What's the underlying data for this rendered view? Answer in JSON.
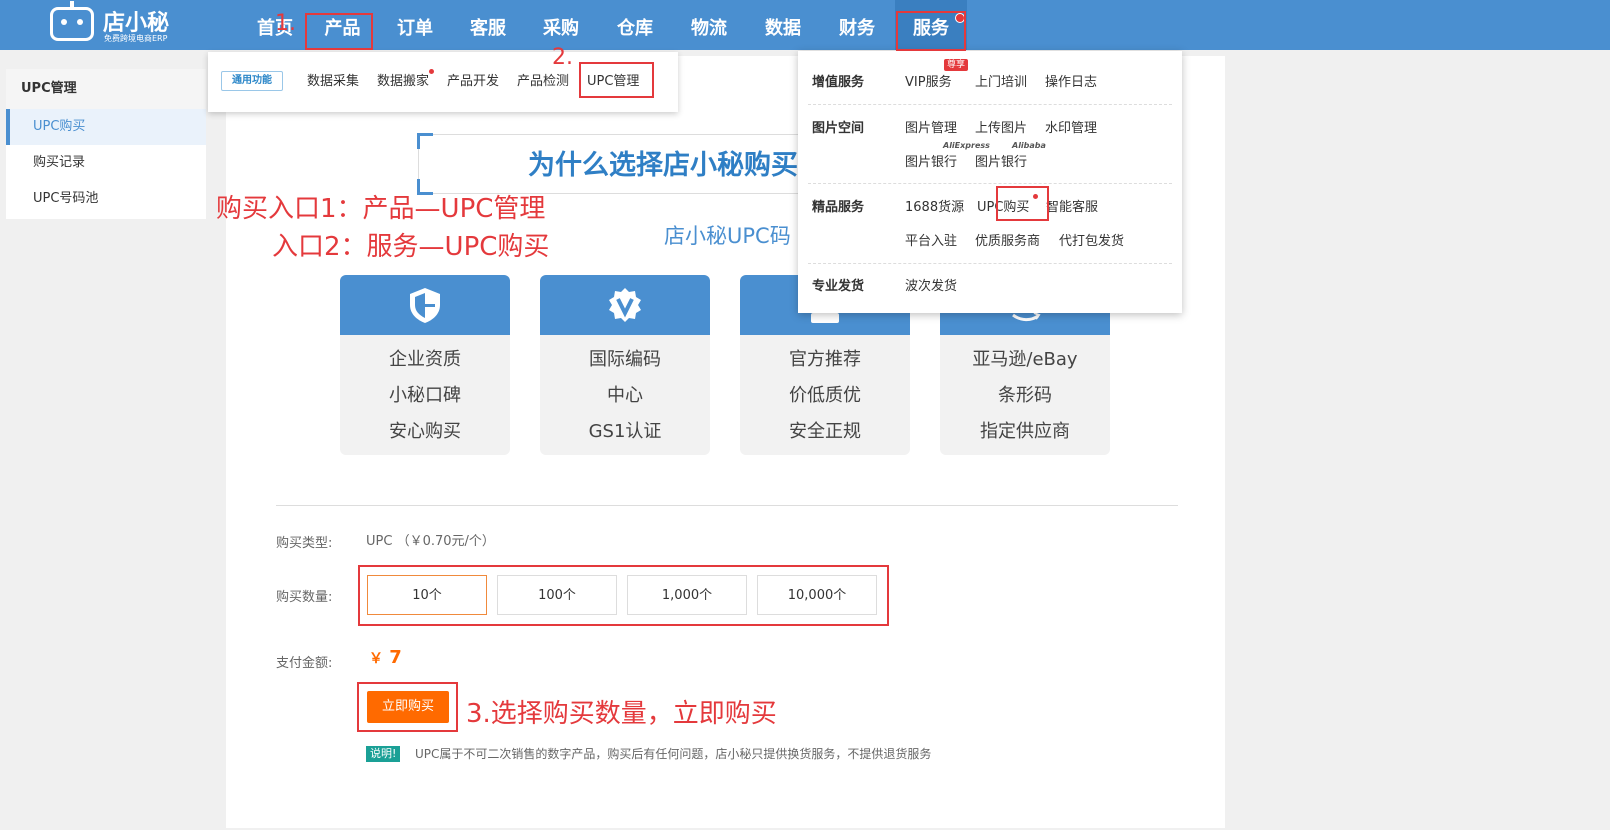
{
  "logo": {
    "name": "店小秘",
    "tagline": "免费跨境电商ERP"
  },
  "nav": [
    "首页",
    "产品",
    "订单",
    "客服",
    "采购",
    "仓库",
    "物流",
    "数据",
    "财务",
    "服务"
  ],
  "sidebar": {
    "title": "UPC管理",
    "items": [
      "UPC购买",
      "购买记录",
      "UPC号码池"
    ]
  },
  "product_menu": {
    "badge": "通用功能",
    "items": [
      "数据采集",
      "数据搬家",
      "产品开发",
      "产品检测",
      "UPC管理"
    ]
  },
  "service_menu": {
    "sections": [
      {
        "title": "增值服务",
        "items": [
          "VIP服务",
          "上门培训",
          "操作日志"
        ]
      },
      {
        "title": "图片空间",
        "items": [
          "图片管理",
          "上传图片",
          "水印管理",
          "图片银行",
          "图片银行"
        ]
      },
      {
        "title": "精品服务",
        "items": [
          "1688货源",
          "UPC购买",
          "智能客服",
          "平台入驻",
          "优质服务商",
          "代打包发货"
        ]
      },
      {
        "title": "专业发货",
        "items": [
          "波次发货"
        ]
      }
    ],
    "vip_tag": "尊享",
    "aliexpress_tag": "AliExpress",
    "alibaba_tag": "Alibaba"
  },
  "annotations": {
    "step1": "1.",
    "step2": "2.",
    "entry1": "购买入口1：产品—UPC管理",
    "entry2": "入口2：服务—UPC购买",
    "step3": "3.选择购买数量，立即购买"
  },
  "main": {
    "headline": "为什么选择店小秘购买",
    "subhead": "店小秘UPC码",
    "cards": [
      {
        "icon": "shield-icon",
        "lines": [
          "企业资质",
          "小秘口碑",
          "安心购买"
        ]
      },
      {
        "icon": "verified-badge-icon",
        "lines": [
          "国际编码",
          "中心",
          "GS1认证"
        ]
      },
      {
        "icon": "thumbs-up-icon",
        "lines": [
          "官方推荐",
          "价低质优",
          "安全正规"
        ]
      },
      {
        "icon": "amazon-icon",
        "lines": [
          "亚马逊/eBay",
          "条形码",
          "指定供应商"
        ]
      }
    ],
    "purchase_type_label": "购买类型:",
    "purchase_type_value": "UPC （￥0.70元/个）",
    "quantity_label": "购买数量:",
    "quantities": [
      "10个",
      "100个",
      "1,000个",
      "10,000个"
    ],
    "selected_quantity": "10个",
    "amount_label": "支付金额:",
    "currency": "￥",
    "amount": "7",
    "buy_button": "立即购买",
    "note_tag": "说明!",
    "note": "UPC属于不可二次销售的数字产品，购买后有任何问题，店小秘只提供换货服务，不提供退货服务"
  },
  "colors": {
    "primary": "#4a8fd0",
    "accent": "#ff6a00",
    "annotation": "#e4393c"
  }
}
